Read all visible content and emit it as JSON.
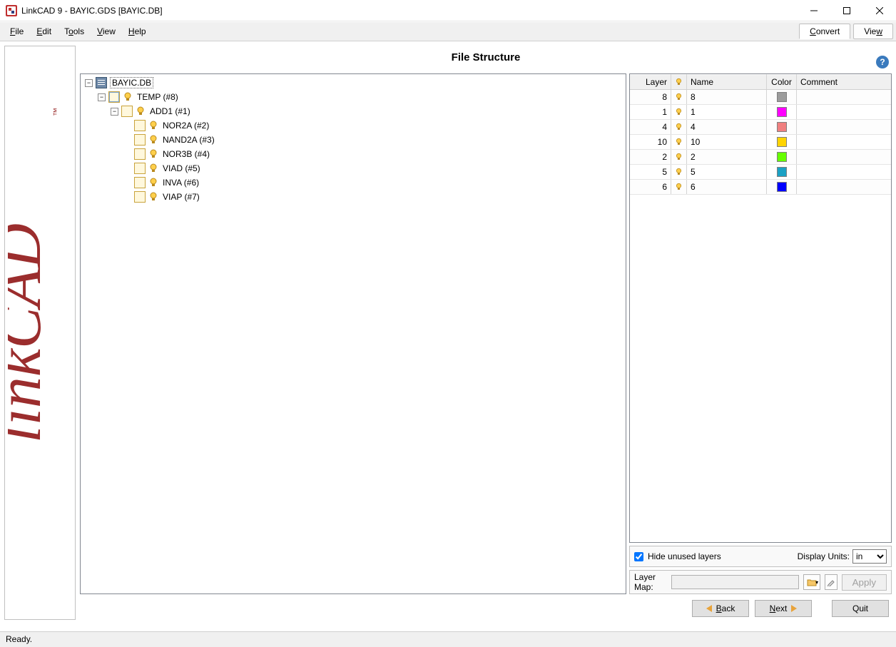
{
  "window": {
    "title": "LinkCAD 9 - BAYIC.GDS [BAYIC.DB]"
  },
  "menu": {
    "file": "File",
    "edit": "Edit",
    "tools": "Tools",
    "view": "View",
    "help": "Help",
    "convert": "Convert",
    "view_tab": "View"
  },
  "page": {
    "title": "File Structure"
  },
  "tree": {
    "root": "BAYIC.DB",
    "temp": "TEMP (#8)",
    "add1": "ADD1 (#1)",
    "children": [
      "NOR2A (#2)",
      "NAND2A (#3)",
      "NOR3B (#4)",
      "VIAD (#5)",
      "INVA (#6)",
      "VIAP (#7)"
    ]
  },
  "layer_table": {
    "headers": {
      "layer": "Layer",
      "name": "Name",
      "color": "Color",
      "comment": "Comment"
    },
    "rows": [
      {
        "layer": "8",
        "name": "8",
        "color": "#9c9c9c",
        "comment": ""
      },
      {
        "layer": "1",
        "name": "1",
        "color": "#ff00ff",
        "comment": ""
      },
      {
        "layer": "4",
        "name": "4",
        "color": "#f08080",
        "comment": ""
      },
      {
        "layer": "10",
        "name": "10",
        "color": "#ffd400",
        "comment": ""
      },
      {
        "layer": "2",
        "name": "2",
        "color": "#66ff00",
        "comment": ""
      },
      {
        "layer": "5",
        "name": "5",
        "color": "#1ba1c4",
        "comment": ""
      },
      {
        "layer": "6",
        "name": "6",
        "color": "#0000ff",
        "comment": ""
      }
    ]
  },
  "options": {
    "hide_unused": "Hide unused layers",
    "hide_unused_checked": true,
    "display_units_label": "Display Units:",
    "display_units_value": "in"
  },
  "layermap": {
    "label": "Layer Map:",
    "value": "",
    "apply": "Apply"
  },
  "nav": {
    "back": "Back",
    "next": "Next",
    "quit": "Quit"
  },
  "status": {
    "text": "Ready."
  }
}
